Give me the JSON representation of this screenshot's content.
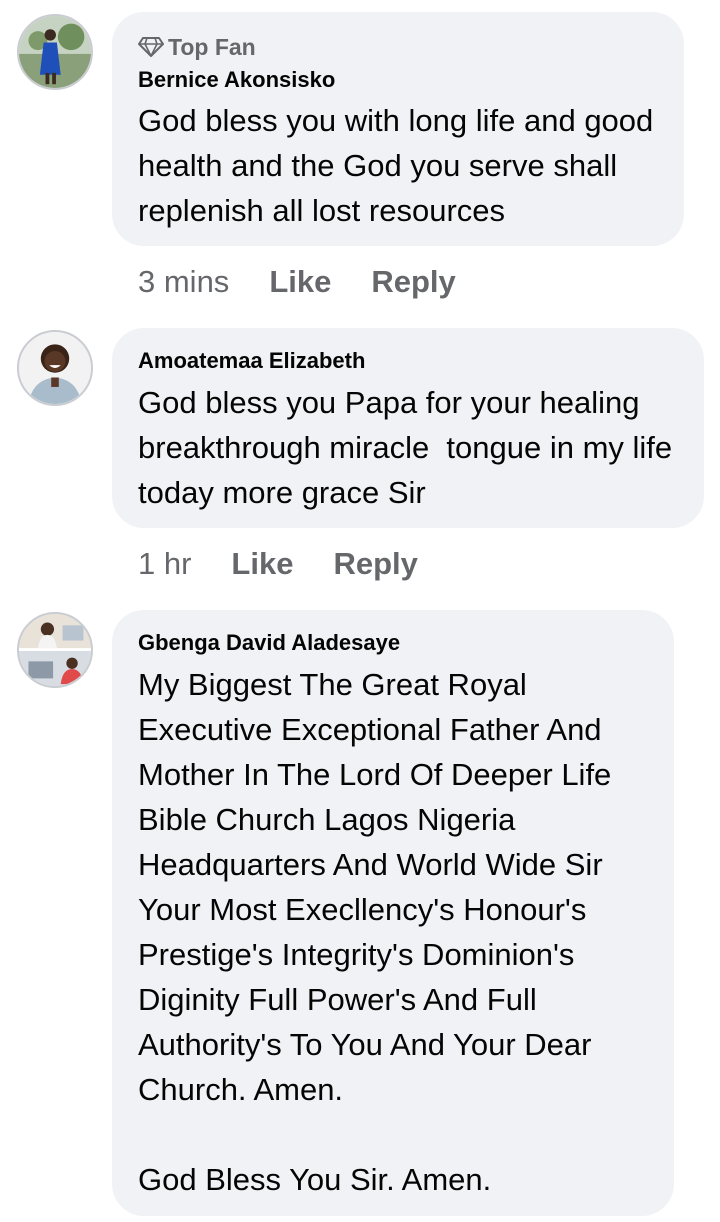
{
  "comments": [
    {
      "badge": "Top Fan",
      "author": "Bernice Akonsisko",
      "text": "God bless you with long life and good health and the God you serve shall replenish all lost resources",
      "time": "3 mins",
      "like_label": "Like",
      "reply_label": "Reply"
    },
    {
      "author": "Amoatemaa Elizabeth",
      "text": "God bless you Papa for your healing breakthrough miracle  tongue in my life today more grace Sir",
      "time": "1 hr",
      "like_label": "Like",
      "reply_label": "Reply"
    },
    {
      "author": "Gbenga David Aladesaye",
      "text": "My Biggest The Great Royal Executive Exceptional Father And Mother In The Lord Of Deeper Life Bible Church Lagos Nigeria Headquarters And World Wide Sir Your Most Execllency's Honour's Prestige's Integrity's Dominion's Diginity Full Power's And Full Authority's To You And Your Dear Church. Amen.\n\nGod Bless You Sir. Amen."
    }
  ],
  "icons": {
    "badge": "diamond-icon"
  },
  "colors": {
    "bubble": "#f0f2f5",
    "secondary_text": "#65676b",
    "primary_text": "#050505"
  }
}
